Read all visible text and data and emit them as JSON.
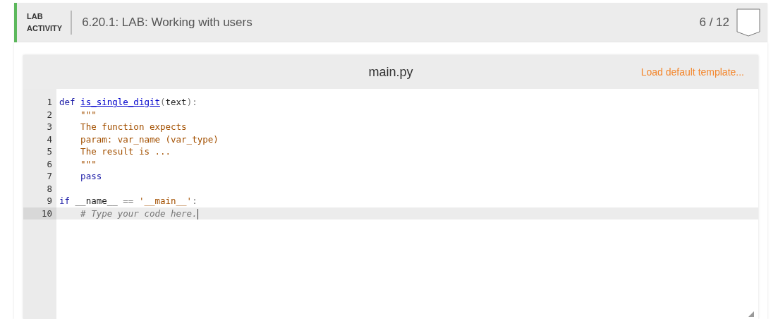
{
  "header": {
    "badge": "LAB\nACTIVITY",
    "title": "6.20.1: LAB: Working with users",
    "score": "6 / 12"
  },
  "editor": {
    "filename": "main.py",
    "action": "Load default template...",
    "lines": [
      {
        "number": "1",
        "selected": false,
        "tokens": [
          {
            "kind": "keyword",
            "text": "def "
          },
          {
            "kind": "name",
            "text": "is_single_digit"
          },
          {
            "kind": "punct",
            "text": "("
          },
          {
            "kind": "plain",
            "text": "text"
          },
          {
            "kind": "punct",
            "text": "):"
          }
        ]
      },
      {
        "number": "2",
        "selected": false,
        "tokens": [
          {
            "kind": "string",
            "text": "    \"\"\""
          }
        ]
      },
      {
        "number": "3",
        "selected": false,
        "tokens": [
          {
            "kind": "string",
            "text": "    The function expects"
          }
        ]
      },
      {
        "number": "4",
        "selected": false,
        "tokens": [
          {
            "kind": "string",
            "text": "    param: var_name (var_type)"
          }
        ]
      },
      {
        "number": "5",
        "selected": false,
        "tokens": [
          {
            "kind": "string",
            "text": "    The result is ..."
          }
        ]
      },
      {
        "number": "6",
        "selected": false,
        "tokens": [
          {
            "kind": "string",
            "text": "    \"\"\""
          }
        ]
      },
      {
        "number": "7",
        "selected": false,
        "tokens": [
          {
            "kind": "keyword",
            "text": "    pass"
          }
        ]
      },
      {
        "number": "8",
        "selected": false
      },
      {
        "number": "9",
        "selected": false,
        "tokens": [
          {
            "kind": "keyword",
            "text": "if "
          },
          {
            "kind": "plain",
            "text": "__name__ "
          },
          {
            "kind": "punct",
            "text": "== "
          },
          {
            "kind": "string",
            "text": "'__main__'"
          },
          {
            "kind": "punct",
            "text": ":"
          }
        ]
      },
      {
        "number": "10",
        "selected": true,
        "tokens": [
          {
            "kind": "comment",
            "text": "    # Type your code here."
          }
        ]
      }
    ]
  }
}
